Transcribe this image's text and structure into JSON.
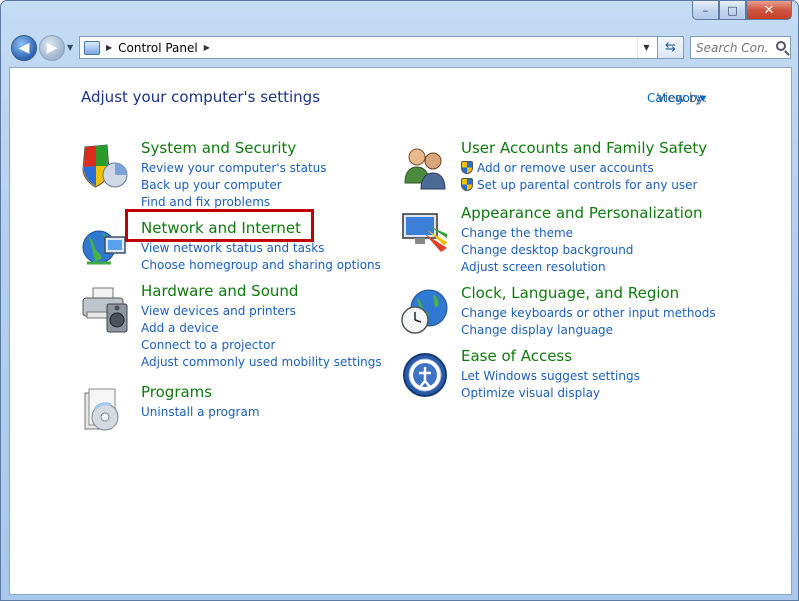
{
  "window": {
    "min": "–",
    "max": "□",
    "close": "✕"
  },
  "address": {
    "path": "Control Panel"
  },
  "search": {
    "placeholder": "Search Con..."
  },
  "main": {
    "title": "Adjust your computer's settings",
    "view_by_label": "View by:",
    "view_by_value": "Category",
    "categories": [
      {
        "title": "System and Security",
        "icon": "system-security-icon",
        "links": [
          {
            "label": "Review your computer's status",
            "shield": false
          },
          {
            "label": "Back up your computer",
            "shield": false
          },
          {
            "label": "Find and fix problems",
            "shield": false
          }
        ]
      },
      {
        "title": "Network and Internet",
        "icon": "network-internet-icon",
        "links": [
          {
            "label": "View network status and tasks",
            "shield": false
          },
          {
            "label": "Choose homegroup and sharing options",
            "shield": false
          }
        ]
      },
      {
        "title": "Hardware and Sound",
        "icon": "hardware-sound-icon",
        "links": [
          {
            "label": "View devices and printers",
            "shield": false
          },
          {
            "label": "Add a device",
            "shield": false
          },
          {
            "label": "Connect to a projector",
            "shield": false
          },
          {
            "label": "Adjust commonly used mobility settings",
            "shield": false
          }
        ]
      },
      {
        "title": "Programs",
        "icon": "programs-icon",
        "links": [
          {
            "label": "Uninstall a program",
            "shield": false
          }
        ]
      },
      {
        "title": "User Accounts and Family Safety",
        "icon": "user-accounts-icon",
        "links": [
          {
            "label": "Add or remove user accounts",
            "shield": true
          },
          {
            "label": "Set up parental controls for any user",
            "shield": true
          }
        ]
      },
      {
        "title": "Appearance and Personalization",
        "icon": "appearance-icon",
        "links": [
          {
            "label": "Change the theme",
            "shield": false
          },
          {
            "label": "Change desktop background",
            "shield": false
          },
          {
            "label": "Adjust screen resolution",
            "shield": false
          }
        ]
      },
      {
        "title": "Clock, Language, and Region",
        "icon": "clock-language-icon",
        "links": [
          {
            "label": "Change keyboards or other input methods",
            "shield": false
          },
          {
            "label": "Change display language",
            "shield": false
          }
        ]
      },
      {
        "title": "Ease of Access",
        "icon": "ease-of-access-icon",
        "links": [
          {
            "label": "Let Windows suggest settings",
            "shield": false
          },
          {
            "label": "Optimize visual display",
            "shield": false
          }
        ]
      }
    ]
  }
}
